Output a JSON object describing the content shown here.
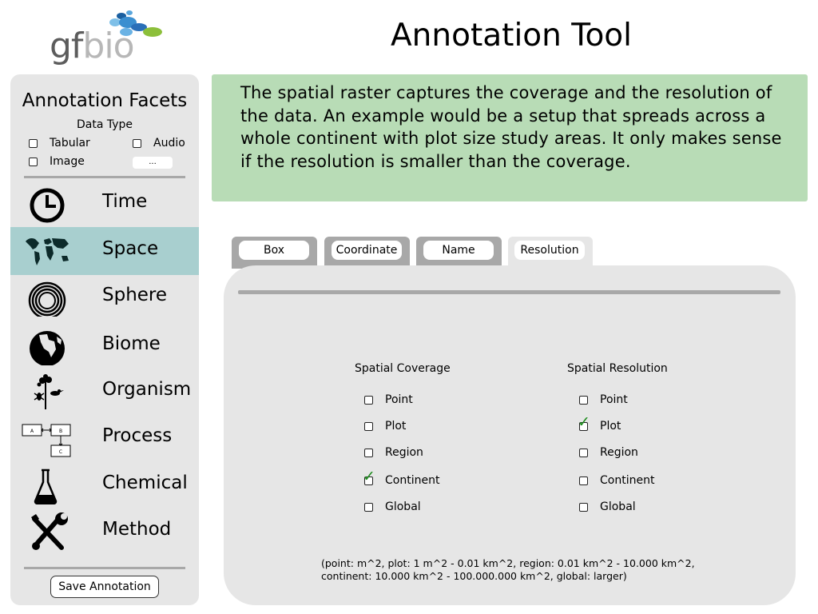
{
  "header": {
    "logo_prefix": "gf",
    "logo_suffix": "bio",
    "title": "Annotation Tool"
  },
  "sidebar": {
    "title": "Annotation Facets",
    "data_type": {
      "title": "Data Type",
      "options": [
        "Tabular",
        "Audio",
        "Image"
      ],
      "more_label": "..."
    },
    "facets": [
      {
        "label": "Time",
        "icon": "clock-icon",
        "active": false
      },
      {
        "label": "Space",
        "icon": "world-map-icon",
        "active": true
      },
      {
        "label": "Sphere",
        "icon": "concentric-circles-icon",
        "active": false
      },
      {
        "label": "Biome",
        "icon": "globe-icon",
        "active": false
      },
      {
        "label": "Organism",
        "icon": "organism-icon",
        "active": false
      },
      {
        "label": "Process",
        "icon": "flow-diagram-icon",
        "active": false
      },
      {
        "label": "Chemical",
        "icon": "flask-icon",
        "active": false
      },
      {
        "label": "Method",
        "icon": "tools-icon",
        "active": false
      }
    ],
    "process_icon_letters": [
      "A",
      "B",
      "C"
    ],
    "save_label": "Save Annotation"
  },
  "description": "The spatial raster captures the coverage and the resolution of the data. An example would be a setup that spreads across a whole continent with plot size study areas. It only makes sense if the resolution is smaller than the coverage.",
  "tabs": [
    {
      "label": "Box",
      "active": false
    },
    {
      "label": "Coordinate",
      "active": false
    },
    {
      "label": "Name",
      "active": false
    },
    {
      "label": "Resolution",
      "active": true
    }
  ],
  "coverage": {
    "title": "Spatial Coverage",
    "options": [
      {
        "label": "Point",
        "checked": false
      },
      {
        "label": "Plot",
        "checked": false
      },
      {
        "label": "Region",
        "checked": false
      },
      {
        "label": "Continent",
        "checked": true
      },
      {
        "label": "Global",
        "checked": false
      }
    ]
  },
  "resolution": {
    "title": "Spatial Resolution",
    "options": [
      {
        "label": "Point",
        "checked": false
      },
      {
        "label": "Plot",
        "checked": true
      },
      {
        "label": "Region",
        "checked": false
      },
      {
        "label": "Continent",
        "checked": false
      },
      {
        "label": "Global",
        "checked": false
      }
    ]
  },
  "note": {
    "line1": "(point: m^2,  plot: 1 m^2 - 0.01 km^2, region: 0.01 km^2 - 10.000 km^2,",
    "line2": "continent: 10.000 km^2 - 100.000.000 km^2, global: larger)"
  },
  "colors": {
    "active_facet": "#a8cfcf",
    "description_bg": "#b8dcb6",
    "panel_bg": "#e6e6e6",
    "tab_bg": "#a8a8a8",
    "check": "#1c8c1c"
  }
}
